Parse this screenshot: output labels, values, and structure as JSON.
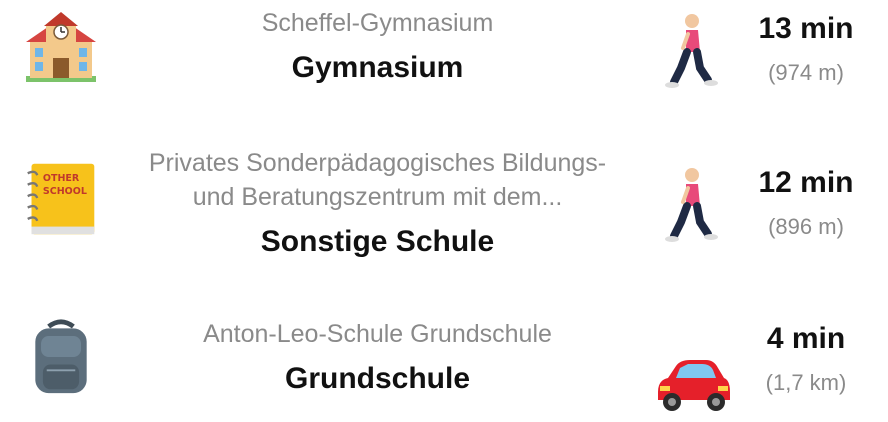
{
  "schools": [
    {
      "icon": "school-building-icon",
      "name": "Scheffel-Gymnasium",
      "type": "Gymnasium",
      "mode_icon": "person-walking-icon",
      "duration": "13 min",
      "distance": "(974 m)"
    },
    {
      "icon": "notebook-icon",
      "icon_text_line1": "OTHER",
      "icon_text_line2": "SCHOOL",
      "name_line1": "Privates Sonderpädagogisches Bildungs-",
      "name_line2": "und Beratungszentrum mit dem...",
      "type": "Sonstige Schule",
      "mode_icon": "person-walking-icon",
      "duration": "12 min",
      "distance": "(896 m)"
    },
    {
      "icon": "backpack-icon",
      "name": "Anton-Leo-Schule Grundschule",
      "type": "Grundschule",
      "mode_icon": "car-icon",
      "duration": "4 min",
      "distance": "(1,7 km)"
    }
  ],
  "colors": {
    "secondary_text": "#8a8a8a",
    "primary_text": "#111111",
    "car_red": "#e5202a",
    "notebook_yellow": "#f7c21b",
    "backpack_gray": "#5c6e7c"
  }
}
